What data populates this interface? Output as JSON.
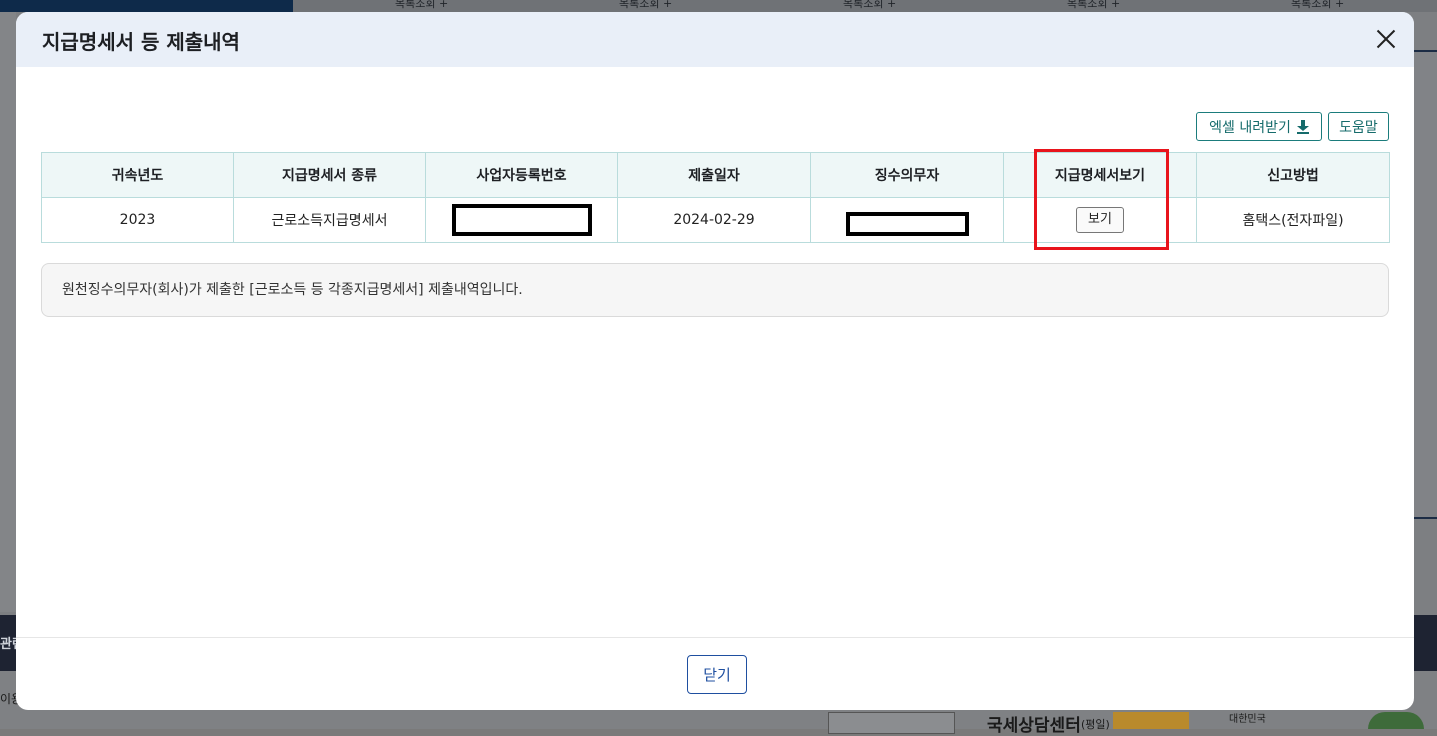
{
  "background": {
    "tabs": [
      "목록조회 +",
      "목록조회 +",
      "목록조회 +",
      "목록조회 +",
      "목록조회 +"
    ],
    "footer_left_1": "관련",
    "footer_left_2": "이용",
    "footer_center": "국세상담센터",
    "footer_center_sub": "(평일)",
    "footer_small": "대한민국"
  },
  "modal": {
    "title": "지급명세서 등 제출내역",
    "toolbar": {
      "excel_label": "엑셀 내려받기",
      "help_label": "도움말"
    },
    "table": {
      "headers": [
        "귀속년도",
        "지급명세서 종류",
        "사업자등록번호",
        "제출일자",
        "징수의무자",
        "지급명세서보기",
        "신고방법"
      ],
      "rows": [
        {
          "year": "2023",
          "type": "근로소득지급명세서",
          "biz_no": "",
          "date": "2024-02-29",
          "payer": "",
          "view_label": "보기",
          "method": "홈택스(전자파일)"
        }
      ]
    },
    "notice": "원천징수의무자(회사)가 제출한 [근로소득 등 각종지급명세서] 제출내역입니다.",
    "close_label": "닫기"
  },
  "colors": {
    "highlight": "#e8141c",
    "header_bg": "#e9eff8",
    "teal": "#156b6b",
    "close_blue": "#1f4fa0"
  }
}
